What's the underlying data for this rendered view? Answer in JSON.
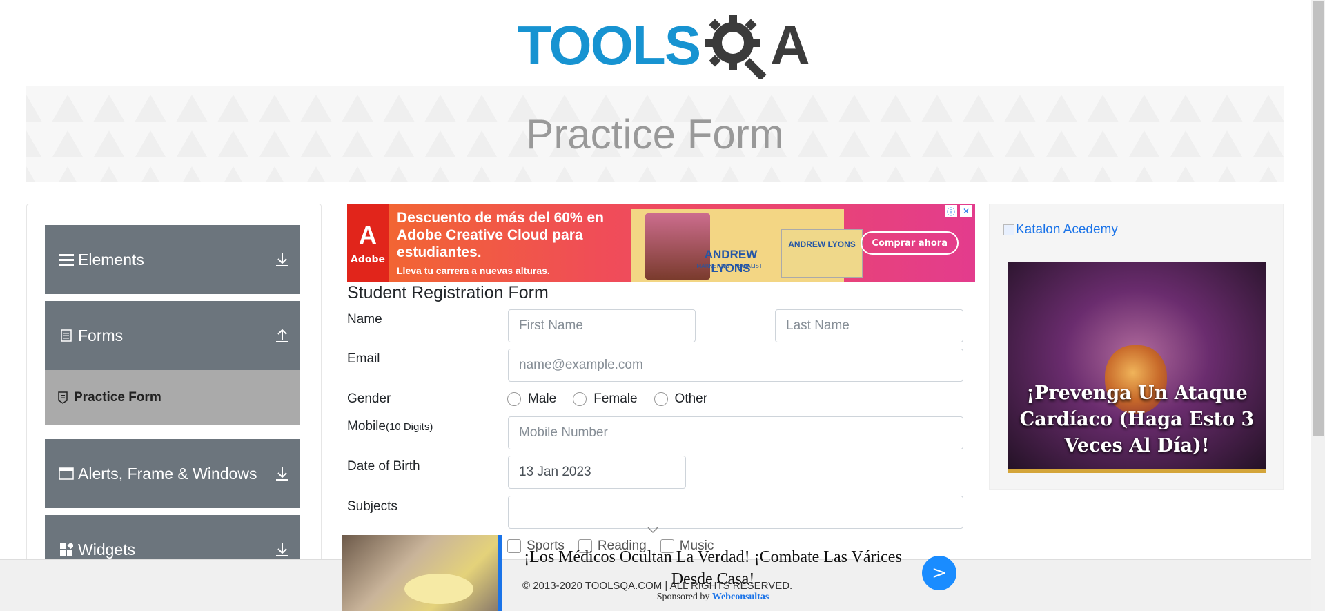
{
  "logo": {
    "text_main": "TOOLS",
    "text_end": "A"
  },
  "banner": {
    "title": "Practice Form"
  },
  "sidebar": {
    "groups": [
      {
        "label": "Elements",
        "icon": "menu-icon",
        "arrow": "download-icon"
      },
      {
        "label": "Forms",
        "icon": "document-icon",
        "arrow": "upload-icon"
      },
      {
        "label": "Alerts, Frame & Windows",
        "icon": "window-icon",
        "arrow": "download-icon"
      },
      {
        "label": "Widgets",
        "icon": "widgets-icon",
        "arrow": "download-icon"
      }
    ],
    "active_item": "Practice Form"
  },
  "ad_top": {
    "brand": "Adobe",
    "headline": "Descuento de más del 60% en Adobe Creative Cloud para estudiantes.",
    "subline": "Lleva tu carrera a nuevas alturas.",
    "person_name": "ANDREW LYONS",
    "person_title": "MARKETING SPECIALIST",
    "cta": "Comprar ahora",
    "info_glyph": "ⓘ",
    "close_glyph": "✕"
  },
  "form": {
    "title": "Student Registration Form",
    "name_label": "Name",
    "first_name_placeholder": "First Name",
    "last_name_placeholder": "Last Name",
    "email_label": "Email",
    "email_placeholder": "name@example.com",
    "gender_label": "Gender",
    "gender_options": [
      "Male",
      "Female",
      "Other"
    ],
    "mobile_label": "Mobile",
    "mobile_hint": "(10 Digits)",
    "mobile_placeholder": "Mobile Number",
    "dob_label": "Date of Birth",
    "dob_value": "13 Jan 2023",
    "subjects_label": "Subjects",
    "hobbies": [
      "Sports",
      "Reading",
      "Music"
    ]
  },
  "ad_right": {
    "link_text": "Katalon Acedemy",
    "headline": "¡Prevenga Un Ataque Cardíaco (Haga Esto 3 Veces Al Día)!"
  },
  "bottom_ad": {
    "headline": "¡Los Médicos Ocultan La Verdad! ¡Combate Las Várices Desde Casa!",
    "sponsor_prefix": "Sponsored by",
    "sponsor_name": "Webconsultas",
    "go_glyph": ">"
  },
  "footer": {
    "copyright": "© 2013-2020 TOOLSQA.COM | ALL RIGHTS RESERVED."
  },
  "colors": {
    "brand_blue": "#1793d1",
    "sidebar_group": "#6c757d",
    "active_item": "#aaaaaa"
  }
}
